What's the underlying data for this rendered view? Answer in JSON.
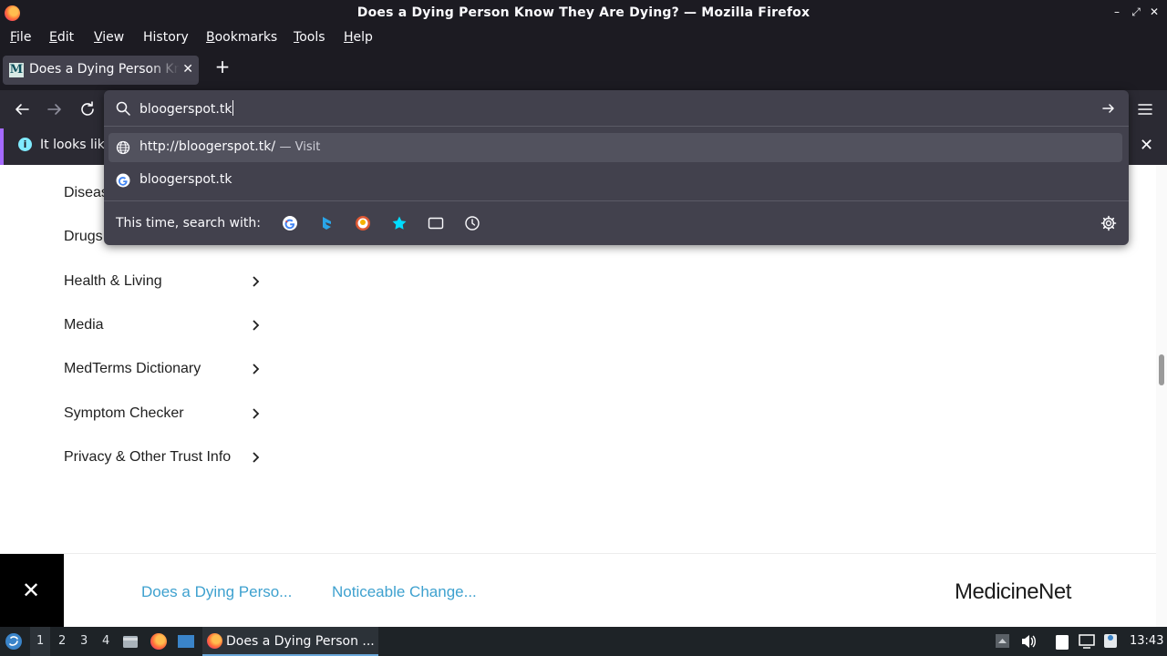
{
  "window": {
    "title": "Does a Dying Person Know They Are Dying? — Mozilla Firefox"
  },
  "menubar": {
    "items": [
      {
        "label": "File",
        "accel": "F",
        "rest": "ile"
      },
      {
        "label": "Edit",
        "accel": "E",
        "rest": "dit"
      },
      {
        "label": "View",
        "accel": "V",
        "rest": "iew"
      },
      {
        "label": "History",
        "accel": "",
        "rest": "History"
      },
      {
        "label": "Bookmarks",
        "accel": "B",
        "rest": "ookmarks"
      },
      {
        "label": "Tools",
        "accel": "T",
        "rest": "ools"
      },
      {
        "label": "Help",
        "accel": "H",
        "rest": "elp"
      }
    ]
  },
  "tab": {
    "title": "Does a Dying Person Know They Are Dying?",
    "favicon_letter": "M"
  },
  "urlbar": {
    "value": "bloogerspot.tk"
  },
  "suggestions": [
    {
      "text": "http://bloogerspot.tk/",
      "action": "— Visit",
      "icon": "globe-icon"
    },
    {
      "text": "bloogerspot.tk",
      "action": "",
      "icon": "google-icon"
    }
  ],
  "search_with": {
    "label": "This time, search with:",
    "engines": [
      "google-icon",
      "bing-icon",
      "duckduckgo-icon",
      "bookmarks-star-icon",
      "tabs-icon",
      "history-clock-icon"
    ]
  },
  "notification": {
    "text": "It looks like"
  },
  "page": {
    "categories": [
      {
        "label": "Diseas"
      },
      {
        "label": "Drugs"
      },
      {
        "label": "Health & Living"
      },
      {
        "label": "Media"
      },
      {
        "label": "MedTerms Dictionary"
      },
      {
        "label": "Symptom Checker"
      },
      {
        "label": "Privacy & Other Trust Info"
      }
    ],
    "bottom_links": [
      "Does a Dying Perso...",
      "Noticeable Change..."
    ],
    "logo": "MedicineNet"
  },
  "taskbar": {
    "workspaces": [
      "1",
      "2",
      "3",
      "4"
    ],
    "active_window": "Does a Dying Person ...",
    "clock": "13:43"
  },
  "colors": {
    "browser_bg": "#1c1b22",
    "toolbar_bg": "#2b2a33",
    "dropdown_bg": "#42414d",
    "link_blue": "#3ea1cf"
  }
}
